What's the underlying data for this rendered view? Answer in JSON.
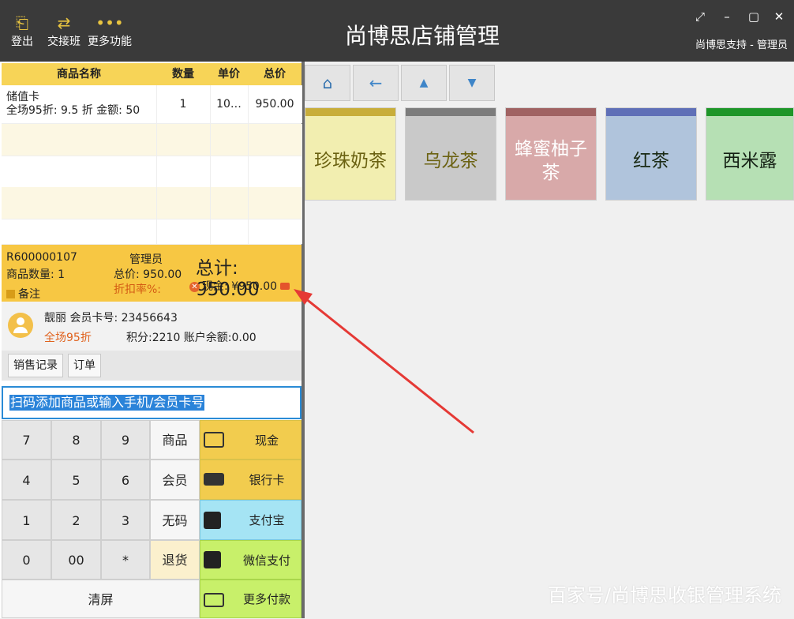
{
  "header": {
    "title": "尚博思店铺管理",
    "user": "尚博思支持 - 管理员",
    "buttons": {
      "logout": "登出",
      "shift": "交接班",
      "more": "更多功能"
    }
  },
  "cart": {
    "columns": [
      "商品名称",
      "数量",
      "单价",
      "总价"
    ],
    "rows": [
      {
        "name": "储值卡",
        "note": "全场95折: 9.5 折  金额: 50",
        "qty": "1",
        "unit_price": "10…",
        "total": "950.00"
      }
    ]
  },
  "summary": {
    "order_no": "R600000107",
    "item_count": "商品数量: 1",
    "remark": "备注",
    "operator": "管理员",
    "subtotal": "总价: 950.00",
    "discount_rate": "折扣率%:",
    "grand_total": "总计: 950.00",
    "cash": "现金: ¥950.00"
  },
  "member": {
    "name_card": "靓丽 会员卡号: 23456643",
    "discount": "全场95折",
    "points": "积分:2210 账户余额:0.00"
  },
  "tabs": {
    "sales": "销售记录",
    "orders": "订单"
  },
  "search": {
    "placeholder": "扫码添加商品或输入手机/会员卡号"
  },
  "keypad": {
    "k7": "7",
    "k8": "8",
    "k9": "9",
    "goods": "商品",
    "k4": "4",
    "k5": "5",
    "k6": "6",
    "member": "会员",
    "k1": "1",
    "k2": "2",
    "k3": "3",
    "nocode": "无码",
    "k0": "0",
    "k00": "00",
    "star": "*",
    "return": "退货",
    "clear": "清屏"
  },
  "payments": {
    "cash": "现金",
    "bank": "银行卡",
    "alipay": "支付宝",
    "wechat": "微信支付",
    "more": "更多付款"
  },
  "categories": [
    {
      "name": "珍珠奶茶",
      "bg": "#f2eeb0",
      "strip": "#c8ad3a",
      "fg": "#6b6212"
    },
    {
      "name": "乌龙茶",
      "bg": "#c9c9c9",
      "strip": "#7c7c7c",
      "fg": "#6b6212"
    },
    {
      "name": "蜂蜜柚子茶",
      "bg": "#d8a9a9",
      "strip": "#a06262",
      "fg": "#ffffff"
    },
    {
      "name": "红茶",
      "bg": "#b0c4dc",
      "strip": "#5f6fb7",
      "fg": "#1a2a14"
    },
    {
      "name": "西米露",
      "bg": "#b6e0b4",
      "strip": "#1e9628",
      "fg": "#142014"
    }
  ],
  "watermark": "百家号/尚博思收银管理系统",
  "colors": {
    "accent": "#f7c743",
    "title_bg": "#3a3a3a",
    "annotation_arrow": "#e53935"
  }
}
